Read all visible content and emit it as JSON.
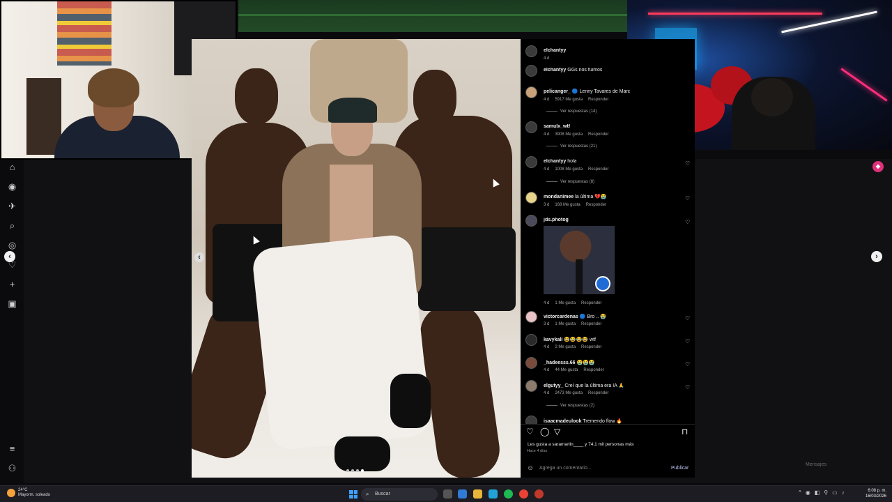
{
  "post": {
    "carousel_dots": 4,
    "active_dot": 3
  },
  "comments": [
    {
      "user": "elchantyy",
      "text": "",
      "time": "4 d",
      "likes": "",
      "reply": "",
      "replies": ""
    },
    {
      "user": "elchantyy",
      "text": "GGs nos fuimos",
      "time": "",
      "likes": "",
      "reply": "",
      "replies": ""
    },
    {
      "user": "pelicanger_",
      "text": "🔵 Lenny Tavares de Marc",
      "time": "4 d",
      "likes": "5917 Me gusta",
      "reply": "Responder",
      "replies": "Ver respuestas (14)"
    },
    {
      "user": "samulx_wtf",
      "text": "",
      "time": "4 d",
      "likes": "3908 Me gusta",
      "reply": "Responder",
      "replies": "Ver respuestas (21)"
    },
    {
      "user": "elchantyy",
      "text": "hola",
      "time": "4 d",
      "likes": "1008 Me gusta",
      "reply": "Responder",
      "replies": "Ver respuestas (8)"
    },
    {
      "user": "mondanimee",
      "text": "la última 💔😭",
      "time": "3 d",
      "likes": "168 Me gusta",
      "reply": "Responder",
      "replies": ""
    },
    {
      "user": "jds.photog",
      "text": "",
      "time": "4 d",
      "likes": "1 Me gusta",
      "reply": "Responder",
      "replies": ""
    },
    {
      "user": "victorcardenas",
      "text": "🔵 Bro .. 😭",
      "time": "3 d",
      "likes": "1 Me gusta",
      "reply": "Responder",
      "replies": ""
    },
    {
      "user": "kavykali",
      "text": "😂😂😂😂 wtf",
      "time": "4 d",
      "likes": "2 Me gusta",
      "reply": "Responder",
      "replies": ""
    },
    {
      "user": "_hadeesss.66",
      "text": "😭😭😭",
      "time": "4 d",
      "likes": "44 Me gusta",
      "reply": "Responder",
      "replies": ""
    },
    {
      "user": "elgutyy_",
      "text": "Creí que la última era IA 🙏",
      "time": "4 d",
      "likes": "2473 Me gusta",
      "reply": "Responder",
      "replies": "Ver respuestas (2)"
    },
    {
      "user": "isaacmadeulook",
      "text": "Tremendo flow 🔥",
      "time": "",
      "likes": "",
      "reply": "",
      "replies": ""
    }
  ],
  "actions": {
    "likes_line": "Les gusta a saramariin____ y 74,1 mil personas más",
    "time_ago": "Hace 4 días",
    "comment_placeholder": "Agrega un comentario...",
    "publish_label": "Publicar"
  },
  "messages_label": "Mensajes",
  "taskbar": {
    "temperature": "24°C",
    "weather_desc": "Mayorm. soleado",
    "search_label": "Buscar",
    "time": "6:08 p. m.",
    "date": "16/03/2026"
  },
  "icons": {
    "like": "heart-icon",
    "comment": "comment-icon",
    "share": "share-icon",
    "save": "bookmark-icon"
  },
  "colors": {
    "panel_bg": "#000000",
    "accent_publish": "#bfc6f3",
    "topbar_green": "#234b27",
    "start_blue": "#3fa0ff"
  }
}
